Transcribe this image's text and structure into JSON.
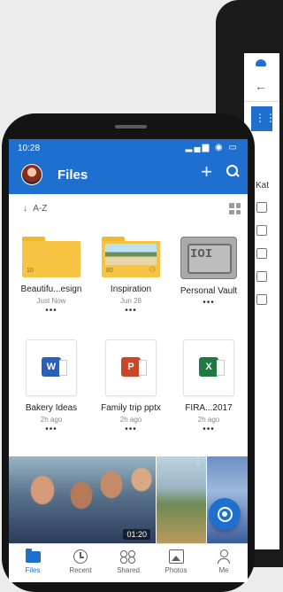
{
  "status_bar": {
    "time": "10:28"
  },
  "header": {
    "title": "Files"
  },
  "sort": {
    "label": "A-Z"
  },
  "files": [
    {
      "name": "Beautifu...esign",
      "subtitle": "Just Now",
      "count": "10",
      "icon": "folder-icon"
    },
    {
      "name": "Inspiration",
      "subtitle": "Jun 28",
      "count": "80",
      "icon": "photo-folder-icon"
    },
    {
      "name": "Personal Vault",
      "subtitle": "",
      "icon": "vault-icon"
    },
    {
      "name": "Bakery Ideas",
      "subtitle": "2h ago",
      "icon": "word-icon",
      "badge": "W"
    },
    {
      "name": "Family trip pptx",
      "subtitle": "2h ago",
      "icon": "powerpoint-icon",
      "badge": "P"
    },
    {
      "name": "FIRA...2017",
      "subtitle": "2h ago",
      "icon": "excel-icon",
      "badge": "X"
    }
  ],
  "more_glyph": "•••",
  "vault_label": "IOI",
  "photos": {
    "duration": "01:20"
  },
  "bottom_nav": [
    {
      "label": "Files",
      "icon": "folder-icon",
      "active": true
    },
    {
      "label": "Recent",
      "icon": "clock-icon",
      "active": false
    },
    {
      "label": "Shared",
      "icon": "people-icon",
      "active": false
    },
    {
      "label": "Photos",
      "icon": "image-icon",
      "active": false
    },
    {
      "label": "Me",
      "icon": "person-icon",
      "active": false
    }
  ],
  "background_device": {
    "side_label": "Kat"
  },
  "colors": {
    "brand_blue": "#1f6fd1",
    "folder_yellow": "#f6c343",
    "word": "#2b5fb8",
    "powerpoint": "#c8472a",
    "excel": "#1f7a42"
  }
}
